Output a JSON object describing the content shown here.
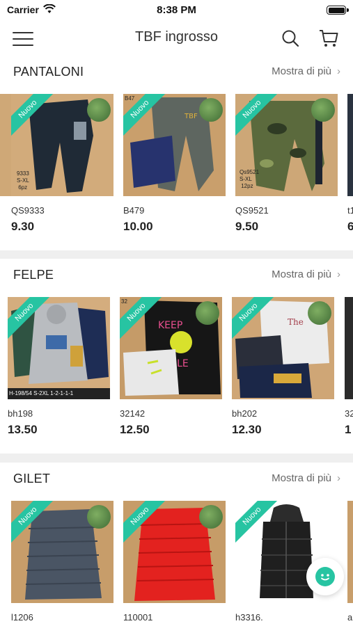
{
  "status_bar": {
    "carrier": "Carrier",
    "time": "8:38 PM"
  },
  "header": {
    "title": "TBF ingrosso",
    "menu_icon": "hamburger-menu-icon",
    "search_icon": "search-icon",
    "cart_icon": "shopping-cart-icon"
  },
  "colors": {
    "ribbon": "#27c4a2",
    "chat_button": "#27c4a2",
    "background": "#efefef"
  },
  "badge_label": "Nuovo",
  "sections": [
    {
      "title": "PANTALONI",
      "more_label": "Mostra di più",
      "products": [
        {
          "sku": "QS9333",
          "price": "9.30",
          "photo_caption": "9333\nS-XL\n6pz"
        },
        {
          "sku": "B479",
          "price": "10.00",
          "photo_caption": "B47"
        },
        {
          "sku": "QS9521",
          "price": "9.50",
          "photo_caption": "Qs9521\nS-XL\n12pz"
        },
        {
          "sku": "t1",
          "price": "6"
        }
      ]
    },
    {
      "title": "FELPE",
      "more_label": "Mostra di più",
      "products": [
        {
          "sku": "bh198",
          "price": "13.50",
          "photo_caption": "H-198/54 S-2XL 1-2-1-1-1"
        },
        {
          "sku": "32142",
          "price": "12.50",
          "photo_caption": "32"
        },
        {
          "sku": "bh202",
          "price": "12.30"
        },
        {
          "sku": "32",
          "price": "1"
        }
      ]
    },
    {
      "title": "GILET",
      "more_label": "Mostra di più",
      "products": [
        {
          "sku": "l1206",
          "price": ""
        },
        {
          "sku": "110001",
          "price": ""
        },
        {
          "sku": "h3316.",
          "price": ""
        },
        {
          "sku": "a",
          "price": ""
        }
      ]
    }
  ]
}
